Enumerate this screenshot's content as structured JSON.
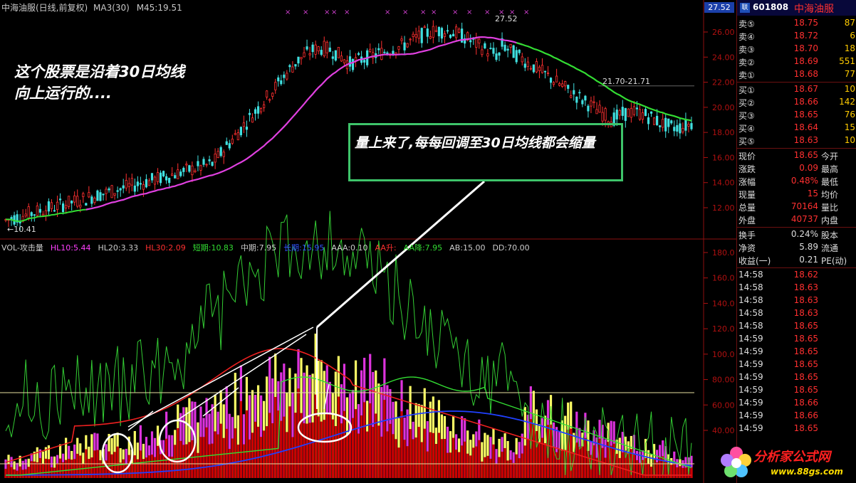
{
  "header": {
    "title": "中海油服(日线,前复权)",
    "ma30": "MA3(30)",
    "ma45": "M45:19.51"
  },
  "price_flag": "27.52",
  "annotations": {
    "high_label": "27.52",
    "low_label": "10.41",
    "level_label": "21.70-21.71",
    "note1": "这个股票是沿着30日均线\n向上运行的....",
    "note2": "量上来了,每每回调至30日均线都会缩量"
  },
  "vol_indicator": [
    {
      "text": "VOL-攻击量",
      "color": "#cccccc"
    },
    {
      "text": "HL10:5.44",
      "color": "#ff40ff"
    },
    {
      "text": "HL20:3.33",
      "color": "#cccccc"
    },
    {
      "text": "HL30:2.09",
      "color": "#ff3030"
    },
    {
      "text": "短期:10.83",
      "color": "#33dd33"
    },
    {
      "text": "中期:7.95",
      "color": "#cccccc"
    },
    {
      "text": "长期:15.95",
      "color": "#3050ff"
    },
    {
      "text": "AAA:0.10",
      "color": "#cccccc"
    },
    {
      "text": "AA升:",
      "color": "#ff3030"
    },
    {
      "text": "AA降:7.95",
      "color": "#33dd33"
    },
    {
      "text": "AB:15.00",
      "color": "#cccccc"
    },
    {
      "text": "DD:70.00",
      "color": "#cccccc"
    }
  ],
  "price_axis": [
    "26.00",
    "24.00",
    "22.00",
    "20.00",
    "18.00",
    "16.00",
    "14.00",
    "12.00"
  ],
  "vol_axis": [
    "180.0",
    "160.0",
    "140.0",
    "120.0",
    "100.0",
    "80.00",
    "60.00",
    "40.00"
  ],
  "panel": {
    "badge": "联",
    "code": "601808",
    "name": "中海油服",
    "sell": [
      {
        "label": "卖⑤",
        "price": "18.75",
        "vol": "87"
      },
      {
        "label": "卖④",
        "price": "18.72",
        "vol": "6"
      },
      {
        "label": "卖③",
        "price": "18.70",
        "vol": "18"
      },
      {
        "label": "卖②",
        "price": "18.69",
        "vol": "551"
      },
      {
        "label": "卖①",
        "price": "18.68",
        "vol": "77"
      }
    ],
    "buy": [
      {
        "label": "买①",
        "price": "18.67",
        "vol": "10"
      },
      {
        "label": "买②",
        "price": "18.66",
        "vol": "142"
      },
      {
        "label": "买③",
        "price": "18.65",
        "vol": "76"
      },
      {
        "label": "买④",
        "price": "18.64",
        "vol": "15"
      },
      {
        "label": "买⑤",
        "price": "18.63",
        "vol": "10"
      }
    ],
    "quote": [
      {
        "label": "现价",
        "value": "18.65",
        "label2": "今开"
      },
      {
        "label": "涨跌",
        "value": "0.09",
        "label2": "最高"
      },
      {
        "label": "涨幅",
        "value": "0.48%",
        "label2": "最低"
      },
      {
        "label": "现量",
        "value": "15",
        "label2": "均价"
      },
      {
        "label": "总量",
        "value": "70164",
        "label2": "量比"
      },
      {
        "label": "外盘",
        "value": "40737",
        "label2": "内盘"
      }
    ],
    "stats": [
      {
        "label": "换手",
        "value": "0.24%",
        "label2": "股本"
      },
      {
        "label": "净资",
        "value": "5.89",
        "label2": "流通"
      },
      {
        "label": "收益(一)",
        "value": "0.21",
        "label2": "PE(动)"
      }
    ],
    "ticks": [
      {
        "time": "14:58",
        "price": "18.62"
      },
      {
        "time": "14:58",
        "price": "18.63"
      },
      {
        "time": "14:58",
        "price": "18.63"
      },
      {
        "time": "14:58",
        "price": "18.63"
      },
      {
        "time": "14:58",
        "price": "18.65"
      },
      {
        "time": "14:59",
        "price": "18.65"
      },
      {
        "time": "14:59",
        "price": "18.65"
      },
      {
        "time": "14:59",
        "price": "18.65"
      },
      {
        "time": "14:59",
        "price": "18.65"
      },
      {
        "time": "14:59",
        "price": "18.65"
      },
      {
        "time": "14:59",
        "price": "18.66"
      },
      {
        "time": "14:59",
        "price": "18.66"
      },
      {
        "time": "14:59",
        "price": "18.65"
      }
    ]
  },
  "watermark": {
    "title": "分析家公式网",
    "url": "www.88gs.com"
  },
  "colors": {
    "up": "#ff3030",
    "down": "#40e0e0",
    "ma30": "#e040e0",
    "ma45": "#33dd33",
    "vol_up": "#ffff66",
    "vol_down": "#dd33dd",
    "vol_base": "#cc0000"
  }
}
